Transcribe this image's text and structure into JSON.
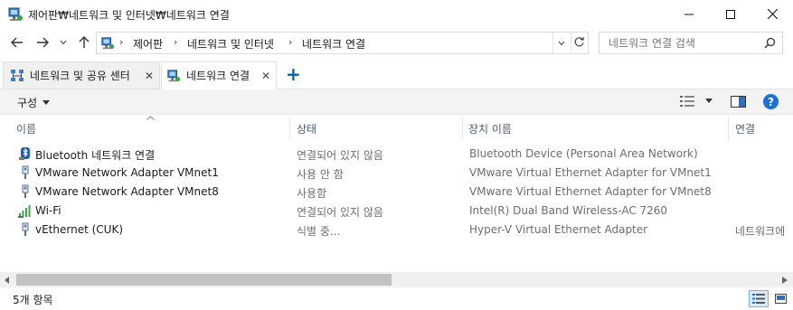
{
  "window": {
    "title": "제어판₩네트워크 및 인터넷₩네트워크 연결"
  },
  "address": {
    "crumbs": [
      "제어판",
      "네트워크 및 인터넷",
      "네트워크 연결"
    ]
  },
  "search": {
    "placeholder": "네트워크 연결 검색"
  },
  "tabs": [
    {
      "label": "네트워크 및 공유 센터",
      "close": "✕"
    },
    {
      "label": "네트워크 연결",
      "close": "✕"
    }
  ],
  "new_tab_glyph": "+",
  "toolbar": {
    "organize_label": "구성"
  },
  "columns": [
    "이름",
    "상태",
    "장치 이름",
    "연결"
  ],
  "rows": [
    {
      "name": "Bluetooth 네트워크 연결",
      "status": "연결되어 있지 않음",
      "device": "Bluetooth Device (Personal Area Network)",
      "conn": "",
      "icon": "bluetooth-network-icon"
    },
    {
      "name": "VMware Network Adapter VMnet1",
      "status": "사용 안 함",
      "device": "VMware Virtual Ethernet Adapter for VMnet1",
      "conn": "",
      "icon": "ethernet-adapter-icon"
    },
    {
      "name": "VMware Network Adapter VMnet8",
      "status": "사용함",
      "device": "VMware Virtual Ethernet Adapter for VMnet8",
      "conn": "",
      "icon": "ethernet-adapter-icon"
    },
    {
      "name": "Wi-Fi",
      "status": "연결되어 있지 않음",
      "device": "Intel(R) Dual Band Wireless-AC 7260",
      "conn": "",
      "icon": "wifi-signal-icon"
    },
    {
      "name": "vEthernet (CUK)",
      "status": "식별 중...",
      "device": "Hyper-V Virtual Ethernet Adapter",
      "conn": "네트워크에",
      "icon": "ethernet-adapter-icon"
    }
  ],
  "status_bar": {
    "item_count": "5개 항목"
  },
  "colors": {
    "accent": "#0063b1",
    "header_text": "#4c607a",
    "help_blue": "#1e6fd9"
  }
}
